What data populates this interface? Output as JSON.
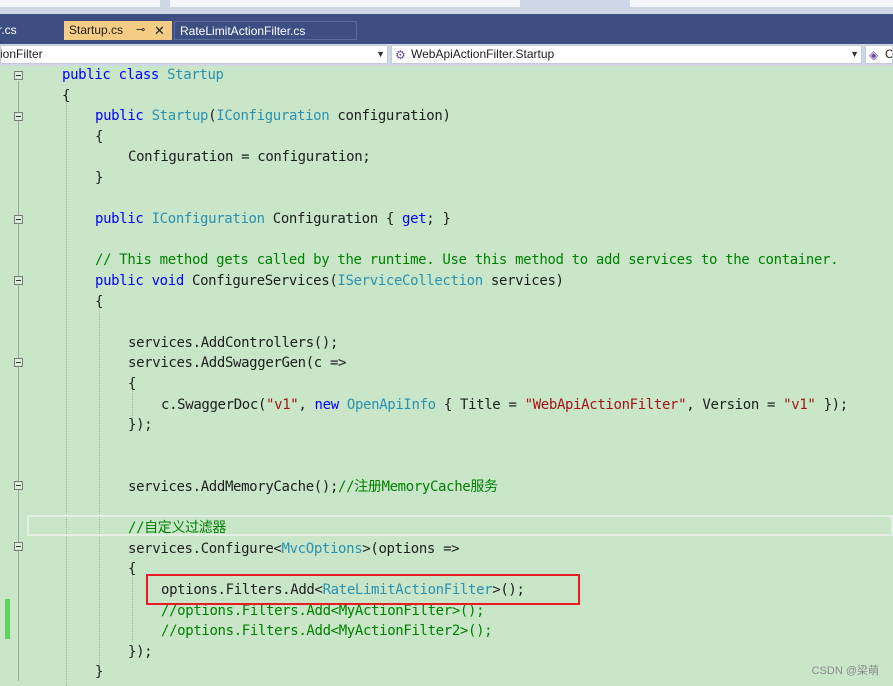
{
  "tabs": [
    {
      "label": "r.cs"
    },
    {
      "label": "Startup.cs",
      "pin_glyph": "⊸",
      "close_glyph": "✕"
    },
    {
      "label": "RateLimitActionFilter.cs"
    }
  ],
  "navbar": {
    "project": "ionFilter",
    "type": "WebApiActionFilter.Startup",
    "member": "C"
  },
  "code_lines": [
    {
      "indent": 0,
      "html": "<span class=\"kw\">public</span> <span class=\"kw\">class</span> <span class=\"ty\">Startup</span>"
    },
    {
      "indent": 0,
      "text": "{"
    },
    {
      "indent": 1,
      "html": "<span class=\"kw\">public</span> <span class=\"ty\">Startup</span>(<span class=\"ty\">IConfiguration</span> configuration)"
    },
    {
      "indent": 1,
      "text": "{"
    },
    {
      "indent": 2,
      "text": "Configuration = configuration;"
    },
    {
      "indent": 1,
      "text": "}"
    },
    {
      "indent": 0,
      "text": ""
    },
    {
      "indent": 1,
      "html": "<span class=\"kw\">public</span> <span class=\"ty\">IConfiguration</span> Configuration { <span class=\"kw\">get</span>; }"
    },
    {
      "indent": 0,
      "text": ""
    },
    {
      "indent": 1,
      "html": "<span class=\"cm\">// This method gets called by the runtime. Use this method to add services to the container.</span>"
    },
    {
      "indent": 1,
      "html": "<span class=\"kw\">public</span> <span class=\"kw\">void</span> ConfigureServices(<span class=\"ty\">IServiceCollection</span> services)"
    },
    {
      "indent": 1,
      "text": "{"
    },
    {
      "indent": 0,
      "text": ""
    },
    {
      "indent": 2,
      "text": "services.AddControllers();"
    },
    {
      "indent": 2,
      "text": "services.AddSwaggerGen(c =>"
    },
    {
      "indent": 2,
      "text": "{"
    },
    {
      "indent": 3,
      "html": "c.SwaggerDoc(<span class=\"str\">\"v1\"</span>, <span class=\"kw\">new</span> <span class=\"ty\">OpenApiInfo</span> { Title = <span class=\"str\">\"WebApiActionFilter\"</span>, Version = <span class=\"str\">\"v1\"</span> });"
    },
    {
      "indent": 2,
      "text": "});"
    },
    {
      "indent": 0,
      "text": ""
    },
    {
      "indent": 0,
      "text": ""
    },
    {
      "indent": 2,
      "html": "services.AddMemoryCache();<span class=\"cm\">//注册MemoryCache服务</span>"
    },
    {
      "indent": 0,
      "text": ""
    },
    {
      "indent": 2,
      "html": "<span class=\"cm\">//自定义过滤器</span>"
    },
    {
      "indent": 2,
      "html": "services.Configure&lt;<span class=\"ty\">MvcOptions</span>&gt;(options =>"
    },
    {
      "indent": 2,
      "text": "{"
    },
    {
      "indent": 3,
      "html": "options.Filters.Add&lt;<span class=\"ty\">RateLimitActionFilter</span>&gt;();"
    },
    {
      "indent": 3,
      "html": "<span class=\"cm\">//options.Filters.Add&lt;MyActionFilter&gt;();</span>"
    },
    {
      "indent": 3,
      "html": "<span class=\"cm\">//options.Filters.Add&lt;MyActionFilter2&gt;();</span>"
    },
    {
      "indent": 2,
      "text": "});"
    },
    {
      "indent": 1,
      "text": "}"
    }
  ],
  "watermark": "CSDN @梁萌",
  "colors": {
    "editor_bg": "#c9e6c9",
    "tab_active": "#f5cc84",
    "tabbar": "#3d4e82",
    "keyword": "#0000ff",
    "type": "#2b91af",
    "string": "#a31515",
    "comment": "#008000",
    "highlight_box": "#e81c24"
  }
}
